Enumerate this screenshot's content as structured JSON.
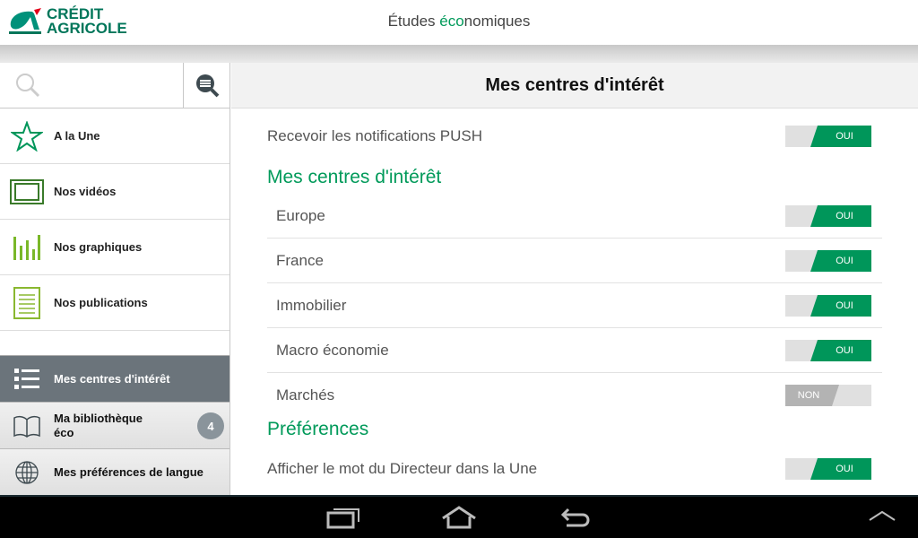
{
  "header": {
    "logo_text_1": "CRÉDIT",
    "logo_text_2": "AGRICOLE",
    "title_pre": "Études ",
    "title_green": "éco",
    "title_post": "nomiques"
  },
  "sidebar": {
    "items": [
      {
        "label": "A la Une",
        "icon": "star-icon"
      },
      {
        "label": "Nos vidéos",
        "icon": "film-icon"
      },
      {
        "label": "Nos graphiques",
        "icon": "bar-chart-icon"
      },
      {
        "label": "Nos publications",
        "icon": "document-icon"
      }
    ],
    "sections": [
      {
        "label": "Mes centres d'intérêt",
        "icon": "list-icon",
        "selected": true
      },
      {
        "label_1": "Ma bibliothèque",
        "label_2": "éco",
        "icon": "book-icon",
        "badge": "4"
      },
      {
        "label": "Mes préférences de langue",
        "icon": "globe-icon"
      }
    ]
  },
  "main": {
    "title": "Mes centres d'intérêt",
    "push": {
      "label": "Recevoir les notifications PUSH",
      "value": "OUI"
    },
    "interests_heading": "Mes centres d'intérêt",
    "interests": [
      {
        "label": "Europe",
        "value": "OUI",
        "on": true
      },
      {
        "label": "France",
        "value": "OUI",
        "on": true
      },
      {
        "label": "Immobilier",
        "value": "OUI",
        "on": true
      },
      {
        "label": "Macro économie",
        "value": "OUI",
        "on": true
      },
      {
        "label": "Marchés",
        "value": "NON",
        "on": false
      }
    ],
    "prefs_heading": "Préférences",
    "director": {
      "label": "Afficher le mot du Directeur dans la Une",
      "value": "OUI"
    }
  },
  "colors": {
    "accent": "#00965a",
    "selected": "#6b747b"
  }
}
